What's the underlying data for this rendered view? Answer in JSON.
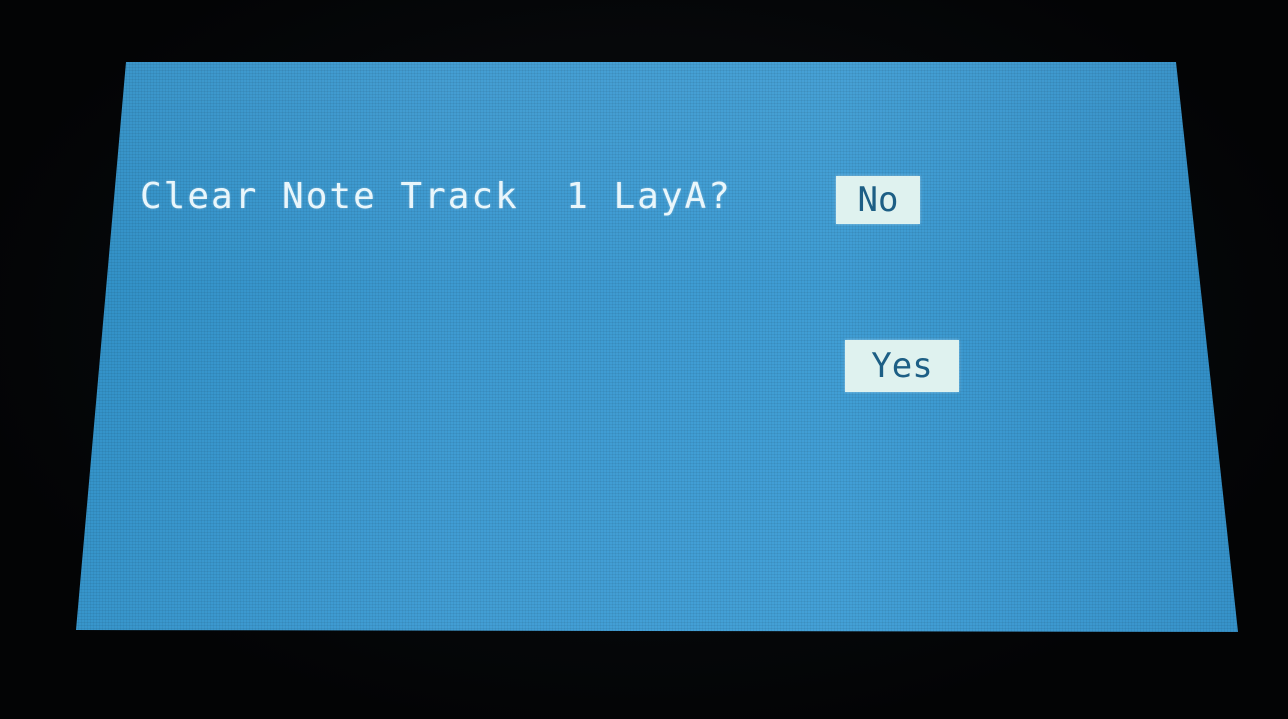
{
  "dialog": {
    "prompt": "Clear Note Track  1 LayA?",
    "no_label": "No",
    "yes_label": "Yes"
  },
  "colors": {
    "screen": "#3d9ad1",
    "text": "#e9f6fb",
    "highlight_bg": "#dff2ef",
    "highlight_text": "#1d5f85"
  }
}
